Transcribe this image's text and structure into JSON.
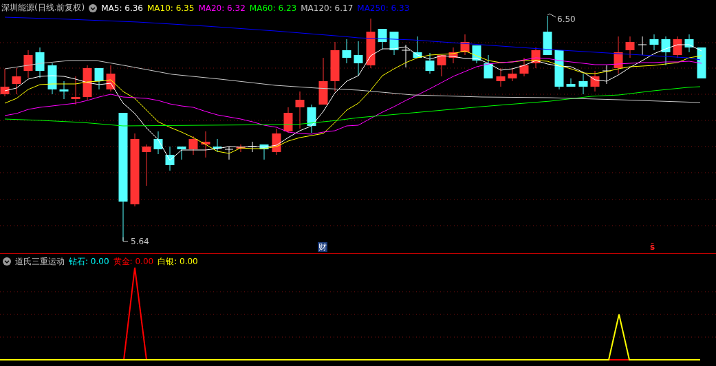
{
  "price_panel": {
    "title": "深圳能源(日线.前复权)",
    "moving_averages": [
      {
        "label": "MA5: 6.36",
        "color": "#ffffff"
      },
      {
        "label": "MA10: 6.35",
        "color": "#ffff00"
      },
      {
        "label": "MA20: 6.32",
        "color": "#ff00ff"
      },
      {
        "label": "MA60: 6.23",
        "color": "#00ff00"
      },
      {
        "label": "MA120: 6.17",
        "color": "#c8c8c8"
      },
      {
        "label": "MA250: 6.33",
        "color": "#0000ff"
      }
    ],
    "high_label": "6.50",
    "low_label": "5.64",
    "markers": [
      {
        "kind": "finance",
        "text": "财"
      },
      {
        "kind": "signal",
        "text": "ŝ"
      }
    ]
  },
  "indicator_panel": {
    "title": "道氏三重运动",
    "values": [
      {
        "label": "钻石: 0.00",
        "color": "#00ffff"
      },
      {
        "label": "黄金: 0.00",
        "color": "#ff0000"
      },
      {
        "label": "白银: 0.00",
        "color": "#ffff00"
      }
    ]
  }
}
